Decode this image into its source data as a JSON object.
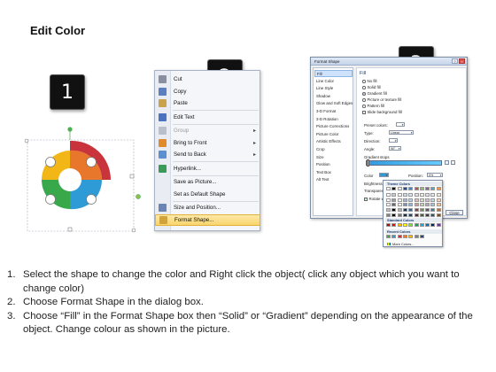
{
  "title": "Edit Color",
  "badges": [
    "1",
    "2",
    "3"
  ],
  "colors": {
    "yellow": "#f2b716",
    "orange": "#e8762b",
    "red": "#c9333b",
    "blue": "#2f9bd6",
    "green": "#38a84a",
    "badge_bg": "#111111",
    "highlight": "#f8d46c"
  },
  "context_menu": {
    "items": [
      {
        "label": "Cut",
        "icon": "scissors-icon",
        "enabled": true,
        "submenu": false
      },
      {
        "label": "Copy",
        "icon": "copy-icon",
        "enabled": true,
        "submenu": false
      },
      {
        "label": "Paste",
        "icon": "paste-icon",
        "enabled": true,
        "submenu": false
      },
      {
        "label": "Edit Text",
        "icon": "edit-text-icon",
        "enabled": true,
        "submenu": false
      },
      {
        "label": "Group",
        "icon": "group-icon",
        "enabled": false,
        "submenu": true
      },
      {
        "label": "Bring to Front",
        "icon": "bring-front-icon",
        "enabled": true,
        "submenu": true
      },
      {
        "label": "Send to Back",
        "icon": "send-back-icon",
        "enabled": true,
        "submenu": true
      },
      {
        "label": "Hyperlink...",
        "icon": "hyperlink-icon",
        "enabled": true,
        "submenu": false
      },
      {
        "label": "Save as Picture...",
        "icon": "",
        "enabled": true,
        "submenu": false
      },
      {
        "label": "Set as Default Shape",
        "icon": "",
        "enabled": true,
        "submenu": false
      },
      {
        "label": "Size and Position...",
        "icon": "size-icon",
        "enabled": true,
        "submenu": false
      },
      {
        "label": "Format Shape...",
        "icon": "format-shape-icon",
        "enabled": true,
        "submenu": false,
        "highlighted": true
      }
    ]
  },
  "format_dialog": {
    "title": "Format Shape",
    "nav": [
      "Fill",
      "Line Color",
      "Line Style",
      "Shadow",
      "Glow and Soft Edges",
      "3-D Format",
      "3-D Rotation",
      "Picture Corrections",
      "Picture Color",
      "Artistic Effects",
      "Crop",
      "Size",
      "Position",
      "Text Box",
      "Alt Text"
    ],
    "nav_selected": "Fill",
    "section": "Fill",
    "fill_options": [
      {
        "label": "No fill",
        "checked": false
      },
      {
        "label": "Solid fill",
        "checked": false
      },
      {
        "label": "Gradient fill",
        "checked": true
      },
      {
        "label": "Picture or texture fill",
        "checked": false
      },
      {
        "label": "Pattern fill",
        "checked": false
      },
      {
        "label": "Slide background fill",
        "checked": false
      }
    ],
    "preset_colors_label": "Preset colors:",
    "type_label": "Type:",
    "type_value": "Linear",
    "direction_label": "Direction:",
    "angle_label": "Angle:",
    "angle_value": "90°",
    "gradient_stops_label": "Gradient stops",
    "color_label": "Color",
    "position_label": "Position:",
    "position_value": "0%",
    "brightness_label": "Brightness:",
    "transparency_label": "Transparency:",
    "rotate_label": "Rotate with shape",
    "close_label": "Close"
  },
  "color_picker": {
    "theme_label": "Theme Colors",
    "standard_label": "Standard Colors",
    "recent_label": "Recent Colors",
    "more_label": "More Colors...",
    "theme_top": [
      "#ffffff",
      "#000000",
      "#eeece1",
      "#1f497d",
      "#4f81bd",
      "#c0504d",
      "#9bbb59",
      "#8064a2",
      "#4bacc6",
      "#f79646"
    ],
    "standard": [
      "#c00000",
      "#ff0000",
      "#ffc000",
      "#ffff00",
      "#92d050",
      "#00b050",
      "#00b0f0",
      "#0070c0",
      "#002060",
      "#7030a0"
    ],
    "recent": [
      "#38a84a",
      "#2f9bd6",
      "#c9333b",
      "#e8762b",
      "#f2b716",
      "#7f7f7f",
      "#1f497d"
    ]
  },
  "steps": [
    {
      "num": "1.",
      "text": "Select the shape to change the color and Right click the object( click any object which you want to change color)"
    },
    {
      "num": "2.",
      "text": "Choose Format Shape in the dialog box."
    },
    {
      "num": "3.",
      "text": "Choose “Fill” in the Format Shape box then “Solid” or “Gradient” depending on the appearance of the object. Change colour as shown in the picture."
    }
  ]
}
